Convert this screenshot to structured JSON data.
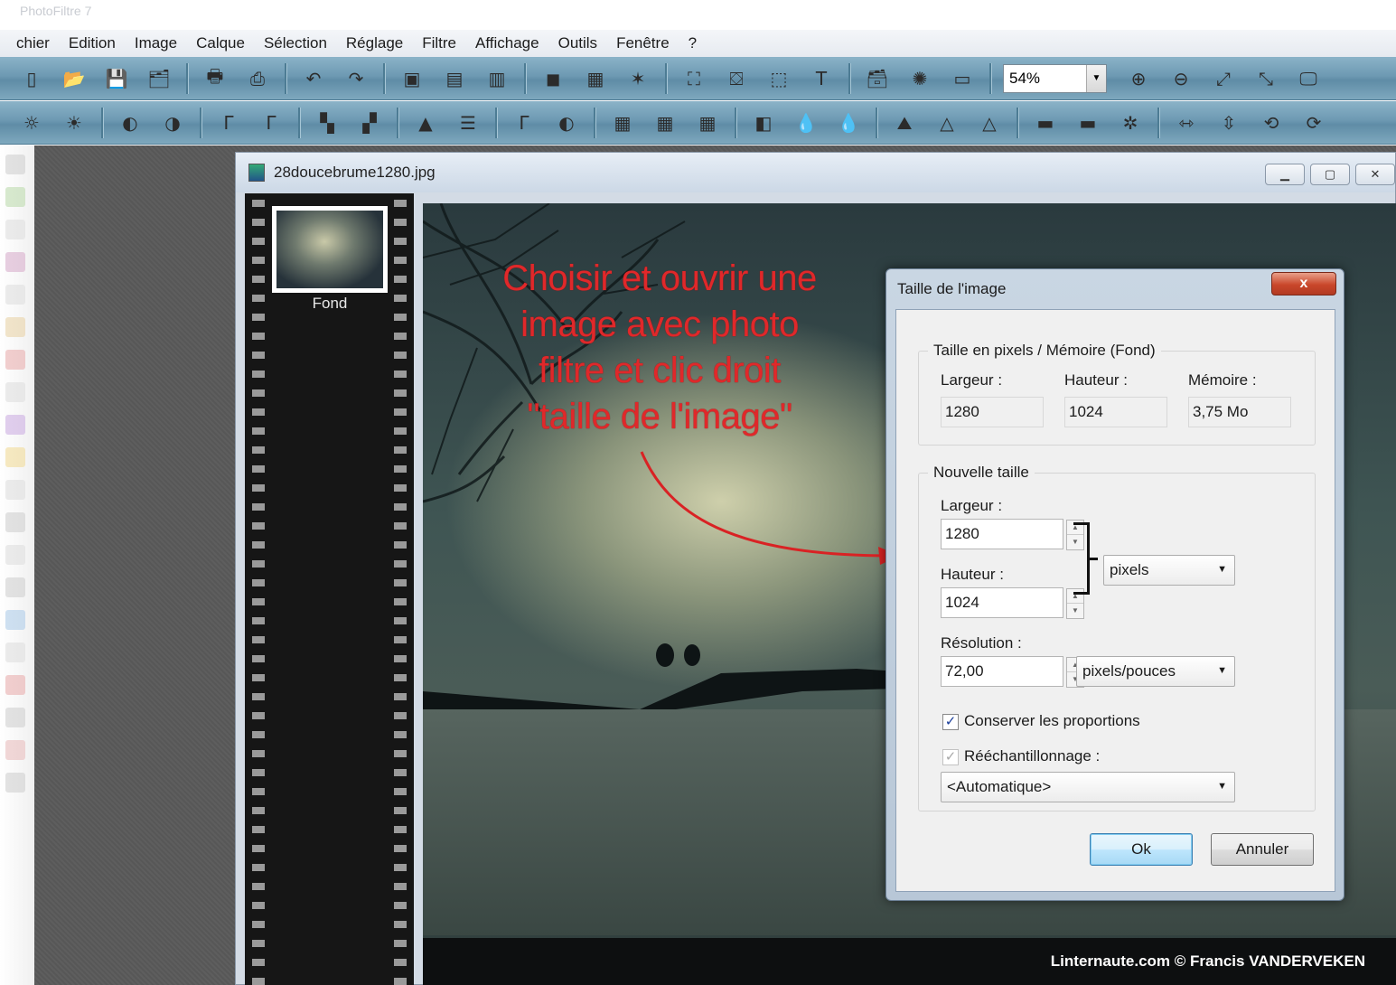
{
  "app": {
    "title": "PhotoFiltre 7"
  },
  "menu": [
    "chier",
    "Edition",
    "Image",
    "Calque",
    "Sélection",
    "Réglage",
    "Filtre",
    "Affichage",
    "Outils",
    "Fenêtre",
    "?"
  ],
  "toolbar": {
    "zoom_value": "54%"
  },
  "image_window": {
    "title": "28doucebrume1280.jpg",
    "thumbnail_caption": "Fond",
    "credit": "Linternaute.com ©  Francis VANDERVEKEN"
  },
  "annotation": {
    "lines": [
      "Choisir et ouvrir une",
      "image avec photo",
      "filtre et clic droit",
      "\"taille de l'image\""
    ],
    "color": "#e0282a"
  },
  "dialog": {
    "title": "Taille de l'image",
    "close_label": "x",
    "group_current": {
      "label": "Taille en pixels / Mémoire (Fond)",
      "largeur_label": "Largeur :",
      "hauteur_label": "Hauteur :",
      "memoire_label": "Mémoire :",
      "largeur_value": "1280",
      "hauteur_value": "1024",
      "memoire_value": "3,75 Mo"
    },
    "group_new": {
      "label": "Nouvelle taille",
      "largeur_label": "Largeur :",
      "largeur_value": "1280",
      "hauteur_label": "Hauteur :",
      "hauteur_value": "1024",
      "unit_value": "pixels",
      "resolution_label": "Résolution :",
      "resolution_value": "72,00",
      "resolution_unit": "pixels/pouces",
      "keep_ratio_label": "Conserver les proportions",
      "keep_ratio_checked": true,
      "resample_label": "Rééchantillonnage :",
      "resample_checked": true,
      "resample_value": "<Automatique>"
    },
    "ok_label": "Ok",
    "cancel_label": "Annuler"
  }
}
